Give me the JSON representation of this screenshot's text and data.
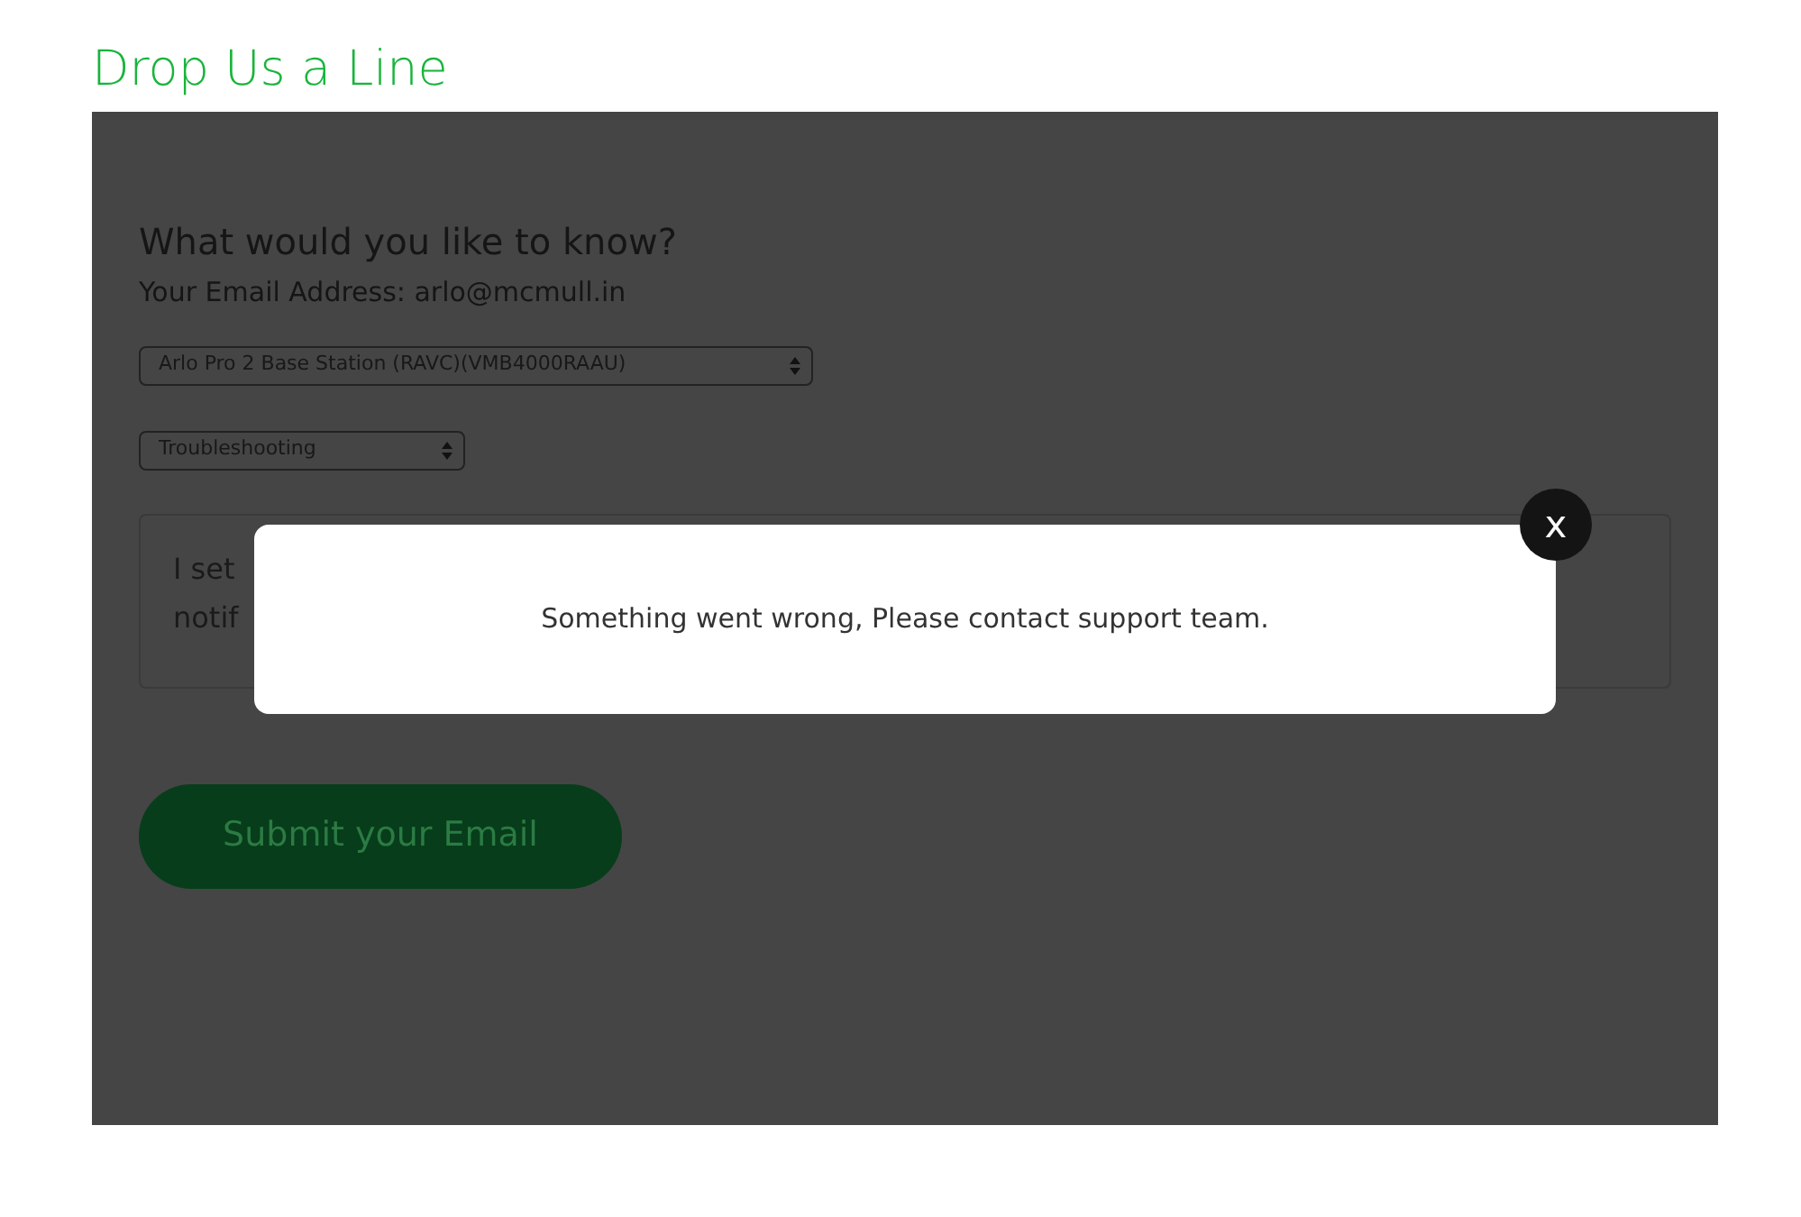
{
  "page_title": "Drop Us a Line",
  "form": {
    "heading": "What would you like to know?",
    "email_label": "Your Email Address: arlo@mcmull.in",
    "device_select": {
      "value": "Arlo Pro 2 Base Station (RAVC)(VMB4000RAAU)"
    },
    "topic_select": {
      "value": "Troubleshooting"
    },
    "message_lines": [
      "I set",
      "notif"
    ],
    "submit": "Submit your Email"
  },
  "modal": {
    "message": "Something went wrong, Please contact support team.",
    "close": "x"
  }
}
